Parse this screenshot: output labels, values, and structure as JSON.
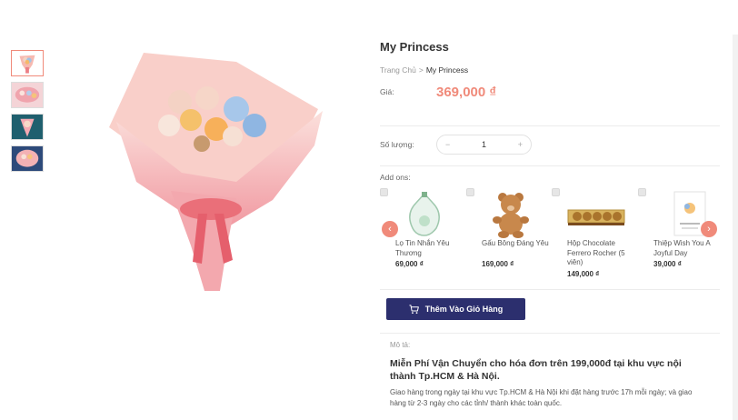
{
  "product": {
    "title": "My Princess",
    "breadcrumb": {
      "home": "Trang Chủ",
      "separator": ">",
      "current": "My Princess"
    },
    "price_label": "Giá:",
    "price": "369,000 ₫",
    "quantity_label": "Số lượng:",
    "quantity": "1",
    "quantity_minus": "−",
    "quantity_plus": "+"
  },
  "thumbnails": [
    {
      "name": "thumbnail-1",
      "active": true
    },
    {
      "name": "thumbnail-2",
      "active": false
    },
    {
      "name": "thumbnail-3",
      "active": false
    },
    {
      "name": "thumbnail-4",
      "active": false
    }
  ],
  "addons": {
    "label": "Add ons:",
    "items": [
      {
        "name": "Lọ Tin Nhắn Yêu Thương",
        "price": "69,000 ₫"
      },
      {
        "name": "Gấu Bông Đáng Yêu",
        "price": "169,000 ₫"
      },
      {
        "name": "Hộp Chocolate Ferrero Rocher (5 viên)",
        "price": "149,000 ₫"
      },
      {
        "name": "Thiệp Wish You A Joyful Day",
        "price": "39,000 ₫"
      }
    ],
    "prev_icon": "‹",
    "next_icon": "›"
  },
  "cart": {
    "label": "Thêm Vào Giỏ Hàng",
    "icon": "cart-icon"
  },
  "description": {
    "label": "Mô tả:",
    "heading": "Miễn Phí Vận Chuyển cho hóa đơn trên 199,000đ tại khu vực nội thành Tp.HCM & Hà Nội.",
    "body": "Giao hàng trong ngày tại khu vực Tp.HCM & Hà Nội khi đặt hàng trước 17h mỗi ngày; và giao hàng từ 2-3 ngày cho các tỉnh/ thành khác toàn quốc."
  },
  "colors": {
    "accent": "#f08a7a",
    "button": "#2c2f6e",
    "text": "#333333",
    "muted": "#999999"
  }
}
